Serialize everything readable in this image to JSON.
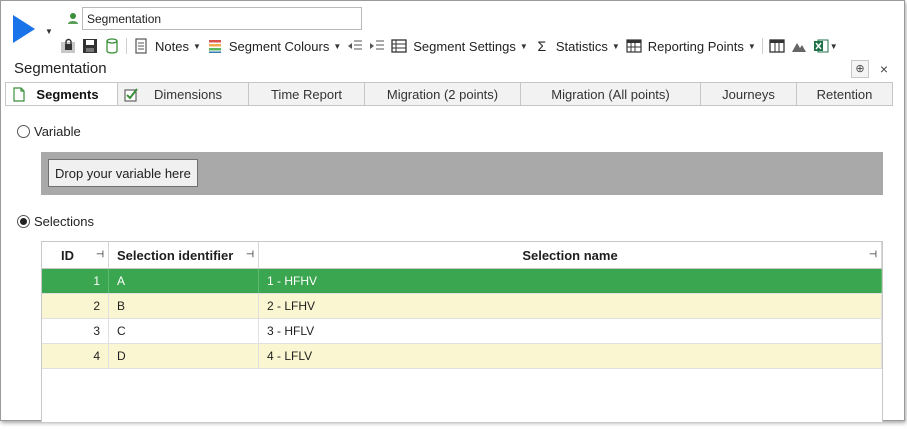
{
  "header": {
    "title_value": "Segmentation"
  },
  "toolbar": {
    "notes_label": "Notes",
    "segment_colours_label": "Segment Colours",
    "segment_settings_label": "Segment Settings",
    "statistics_label": "Statistics",
    "reporting_points_label": "Reporting Points"
  },
  "panel": {
    "title": "Segmentation",
    "pin_glyph": "⊕",
    "close_glyph": "×"
  },
  "tabs": [
    {
      "label": "Segments"
    },
    {
      "label": "Dimensions"
    },
    {
      "label": "Time Report"
    },
    {
      "label": "Migration (2 points)"
    },
    {
      "label": "Migration (All points)"
    },
    {
      "label": "Journeys"
    },
    {
      "label": "Retention"
    }
  ],
  "variable": {
    "radio_label": "Variable",
    "drop_button": "Drop your variable here"
  },
  "selections": {
    "radio_label": "Selections",
    "columns": {
      "id": "ID",
      "identifier": "Selection identifier",
      "name": "Selection name"
    },
    "rows": [
      {
        "id": "1",
        "identifier": "A",
        "name": "1 - HFHV"
      },
      {
        "id": "2",
        "identifier": "B",
        "name": "2 - LFHV"
      },
      {
        "id": "3",
        "identifier": "C",
        "name": "3 - HFLV"
      },
      {
        "id": "4",
        "identifier": "D",
        "name": "4 - LFLV"
      }
    ]
  },
  "colors": {
    "run_accent": "#1a73e8",
    "selected_row": "#3aa64f",
    "alt_row": "#fbf6d2",
    "drop_zone": "#a9a9a9"
  }
}
